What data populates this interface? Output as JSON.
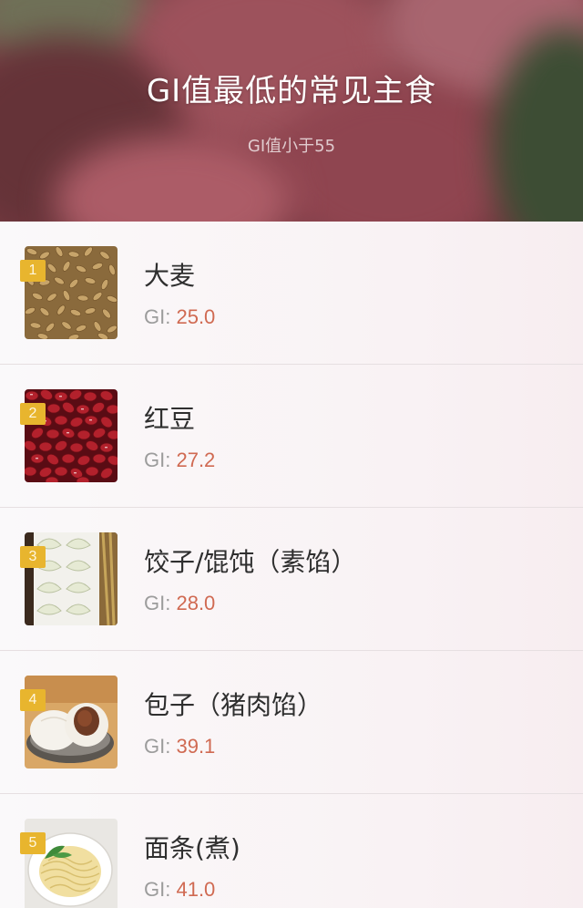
{
  "header": {
    "title": "GI值最低的常见主食",
    "subtitle": "GI值小于55"
  },
  "items": [
    {
      "rank": "1",
      "name": "大麦",
      "gi_label": "GI:",
      "gi_value": "25.0",
      "image": "barley-image"
    },
    {
      "rank": "2",
      "name": "红豆",
      "gi_label": "GI:",
      "gi_value": "27.2",
      "image": "red-bean-image"
    },
    {
      "rank": "3",
      "name": "饺子/馄饨（素馅）",
      "gi_label": "GI:",
      "gi_value": "28.0",
      "image": "dumplings-image"
    },
    {
      "rank": "4",
      "name": "包子（猪肉馅）",
      "gi_label": "GI:",
      "gi_value": "39.1",
      "image": "steamed-bun-image"
    },
    {
      "rank": "5",
      "name": "面条(煮)",
      "gi_label": "GI:",
      "gi_value": "41.0",
      "image": "noodles-image"
    }
  ],
  "colors": {
    "rank_badge": "#e8b52e",
    "gi_value": "#d06a52",
    "gi_label": "#9c9c9c",
    "name": "#2f2f2f"
  }
}
